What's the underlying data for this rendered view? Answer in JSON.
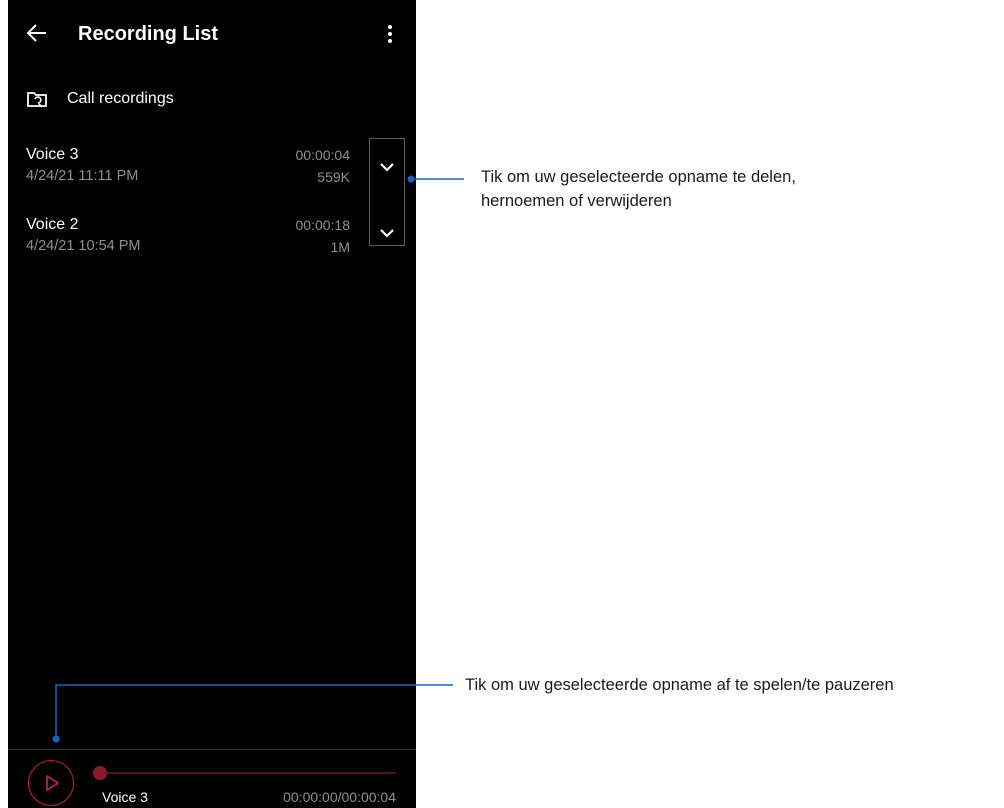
{
  "header": {
    "title": "Recording List",
    "back_icon": "arrow-left-icon",
    "menu_icon": "more-vertical-icon"
  },
  "folder": {
    "icon": "folder-sync-icon",
    "label": "Call recordings"
  },
  "recordings": [
    {
      "name": "Voice 3",
      "date": "4/24/21 11:11 PM",
      "duration": "00:00:04",
      "size": "559K"
    },
    {
      "name": "Voice 2",
      "date": "4/24/21 10:54 PM",
      "duration": "00:00:18",
      "size": "1M"
    }
  ],
  "player": {
    "now_playing": "Voice 3",
    "time": "00:00:00/00:00:04",
    "progress": 0,
    "accent_color": "#c2185b"
  },
  "annotations": {
    "expand_line1": "Tik om uw geselecteerde opname te delen,",
    "expand_line2": "hernoemen of verwijderen",
    "play": "Tik om uw geselecteerde opname af te spelen/te pauzeren",
    "callout_color": "#1565c0"
  }
}
